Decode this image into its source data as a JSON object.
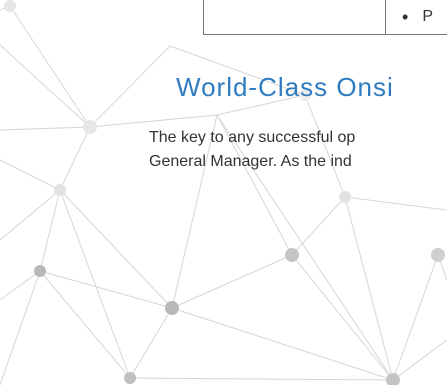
{
  "table_fragment": {
    "right_cell_text": "P"
  },
  "section": {
    "heading": "World-Class Onsi",
    "paragraph_line_1": "The key to any successful op",
    "paragraph_line_2": "General Manager. As the ind"
  },
  "colors": {
    "heading": "#2f7cc1",
    "text": "#333333",
    "network_line": "#d6d6d6",
    "network_node_light": "#e6e6e6",
    "network_node_dark": "#b8b8b8"
  }
}
